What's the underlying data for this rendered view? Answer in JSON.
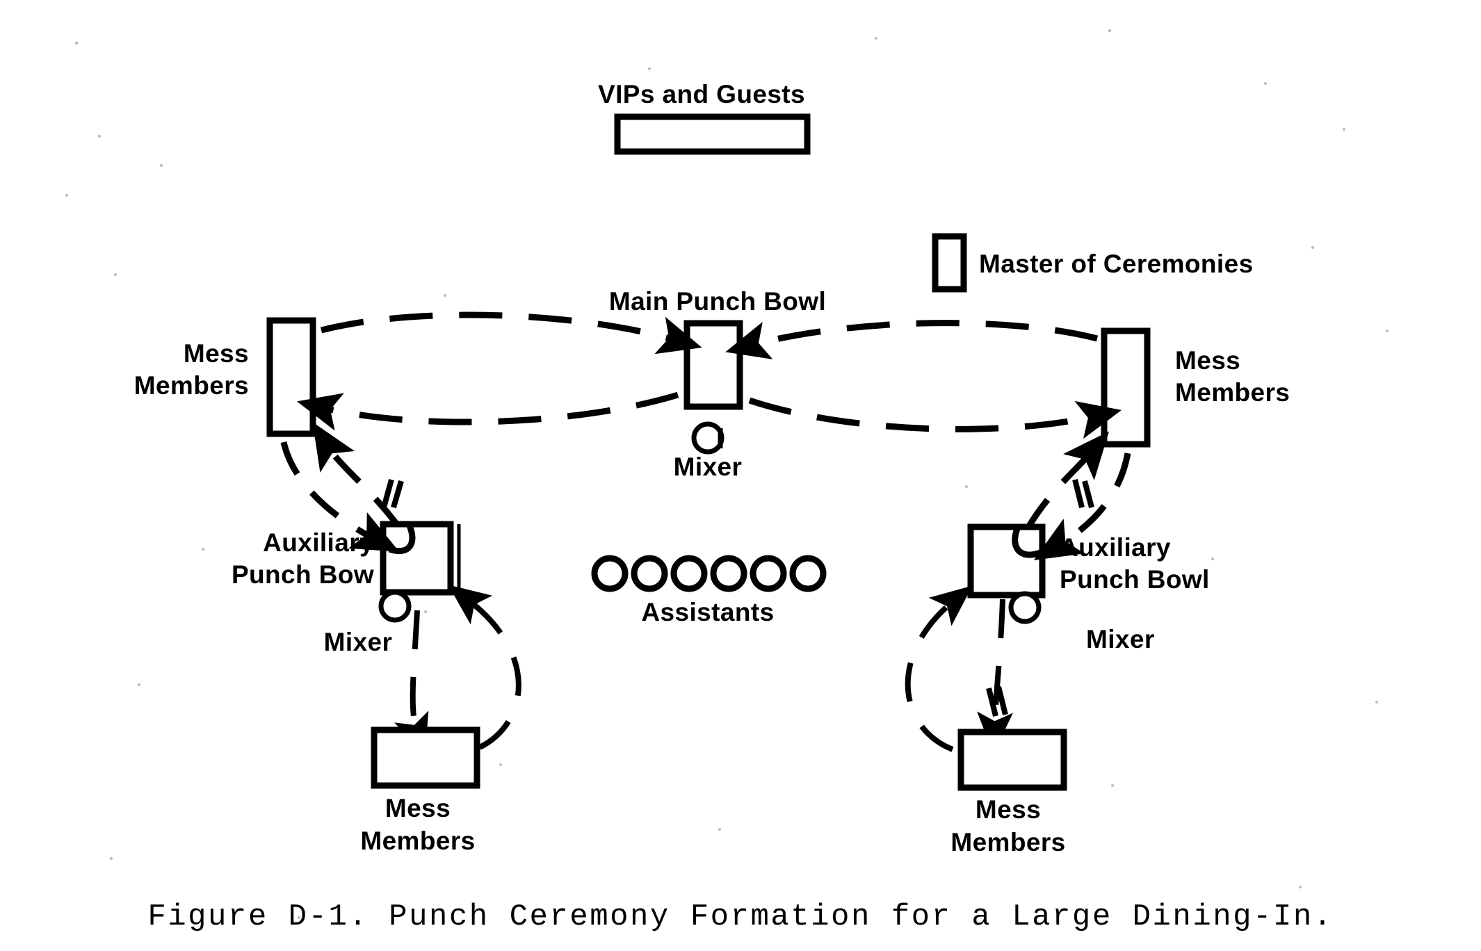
{
  "figure": {
    "caption": "Figure D-1.  Punch Ceremony Formation for a Large Dining-In.",
    "caption_number": "Figure D-1.",
    "caption_title": "Punch Ceremony Formation for a Large Dining-In."
  },
  "nodes": {
    "vips_and_guests": {
      "label": "VIPs and Guests",
      "shape": "rectangle",
      "orientation": "horizontal"
    },
    "master_of_ceremonies": {
      "label": "Master of Ceremonies",
      "shape": "rectangle",
      "orientation": "vertical"
    },
    "main_punch_bowl": {
      "label": "Main Punch Bowl",
      "shape": "rectangle",
      "orientation": "vertical"
    },
    "main_mixer": {
      "label": "Mixer",
      "shape": "circle"
    },
    "mess_members_left": {
      "label_line1": "Mess",
      "label_line2": "Members",
      "shape": "rectangle",
      "orientation": "vertical"
    },
    "mess_members_right": {
      "label_line1": "Mess",
      "label_line2": "Members",
      "shape": "rectangle",
      "orientation": "vertical"
    },
    "aux_punch_bowl_left": {
      "label_line1": "Auxiliary",
      "label_line2": "Punch Bow",
      "shape": "rectangle",
      "orientation": "square"
    },
    "aux_mixer_left": {
      "label": "Mixer",
      "shape": "circle"
    },
    "aux_punch_bowl_right": {
      "label_line1": "Auxiliary",
      "label_line2": "Punch Bowl",
      "shape": "rectangle",
      "orientation": "square"
    },
    "aux_mixer_right": {
      "label": "Mixer",
      "shape": "circle"
    },
    "mess_members_bottom_left": {
      "label_line1": "Mess",
      "label_line2": "Members",
      "shape": "rectangle",
      "orientation": "horizontal"
    },
    "mess_members_bottom_right": {
      "label_line1": "Mess",
      "label_line2": "Members",
      "shape": "rectangle",
      "orientation": "horizontal"
    },
    "assistants": {
      "label": "Assistants",
      "shape": "circle",
      "count": 6
    }
  },
  "colors": {
    "ink": "#000000",
    "paper": "#ffffff"
  },
  "flows": [
    {
      "from": "mess_members_left",
      "to": "main_punch_bowl",
      "style": "dashed",
      "direction": "right"
    },
    {
      "from": "main_punch_bowl",
      "to": "mess_members_left",
      "style": "dashed",
      "direction": "left"
    },
    {
      "from": "mess_members_right",
      "to": "main_punch_bowl",
      "style": "dashed",
      "direction": "left"
    },
    {
      "from": "main_punch_bowl",
      "to": "mess_members_right",
      "style": "dashed",
      "direction": "right"
    },
    {
      "from": "mess_members_left",
      "to": "aux_punch_bowl_left",
      "style": "dashed",
      "direction": "down"
    },
    {
      "from": "aux_punch_bowl_left",
      "to": "mess_members_left",
      "style": "dashed",
      "direction": "up"
    },
    {
      "from": "aux_punch_bowl_left",
      "to": "mess_members_bottom_left",
      "style": "dashed",
      "direction": "down"
    },
    {
      "from": "mess_members_bottom_left",
      "to": "aux_punch_bowl_left",
      "style": "dashed",
      "direction": "up"
    },
    {
      "from": "mess_members_right",
      "to": "aux_punch_bowl_right",
      "style": "dashed",
      "direction": "down"
    },
    {
      "from": "aux_punch_bowl_right",
      "to": "mess_members_right",
      "style": "dashed",
      "direction": "up"
    },
    {
      "from": "aux_punch_bowl_right",
      "to": "mess_members_bottom_right",
      "style": "dashed",
      "direction": "down"
    },
    {
      "from": "mess_members_bottom_right",
      "to": "aux_punch_bowl_right",
      "style": "dashed",
      "direction": "up"
    }
  ]
}
